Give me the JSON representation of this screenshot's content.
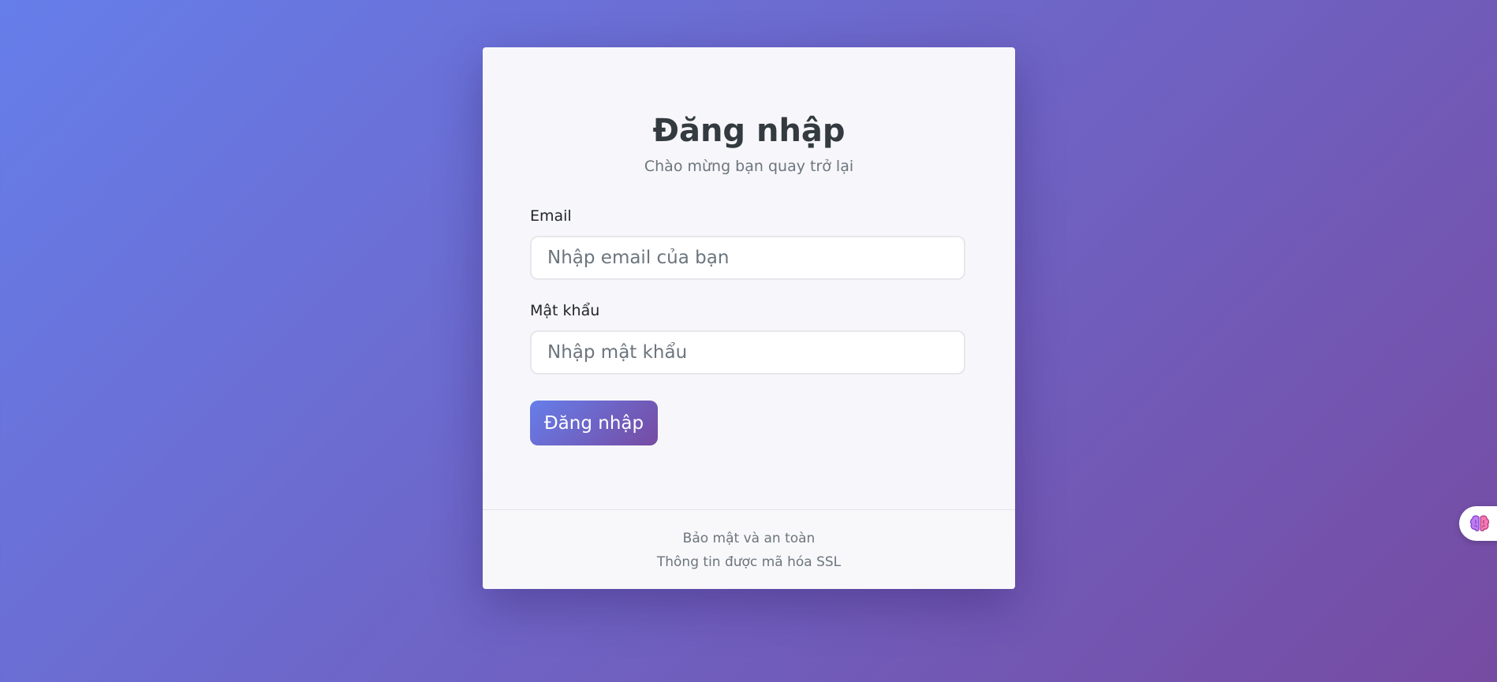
{
  "login": {
    "title": "Đăng nhập",
    "subtitle": "Chào mừng bạn quay trở lại",
    "email_label": "Email",
    "email_placeholder": "Nhập email của bạn",
    "email_value": "",
    "password_label": "Mật khẩu",
    "password_placeholder": "Nhập mật khẩu",
    "password_value": "",
    "submit_label": "Đăng nhập"
  },
  "footer": {
    "line1": "Bảo mật và an toàn",
    "line2": "Thông tin được mã hóa SSL"
  },
  "floating_widget": {
    "icon": "brain-icon"
  },
  "colors": {
    "gradient_start": "#667eea",
    "gradient_end": "#764ba2",
    "card_background": "#f7f7fb",
    "title_color": "#333a40",
    "muted_text": "#6c757d"
  }
}
